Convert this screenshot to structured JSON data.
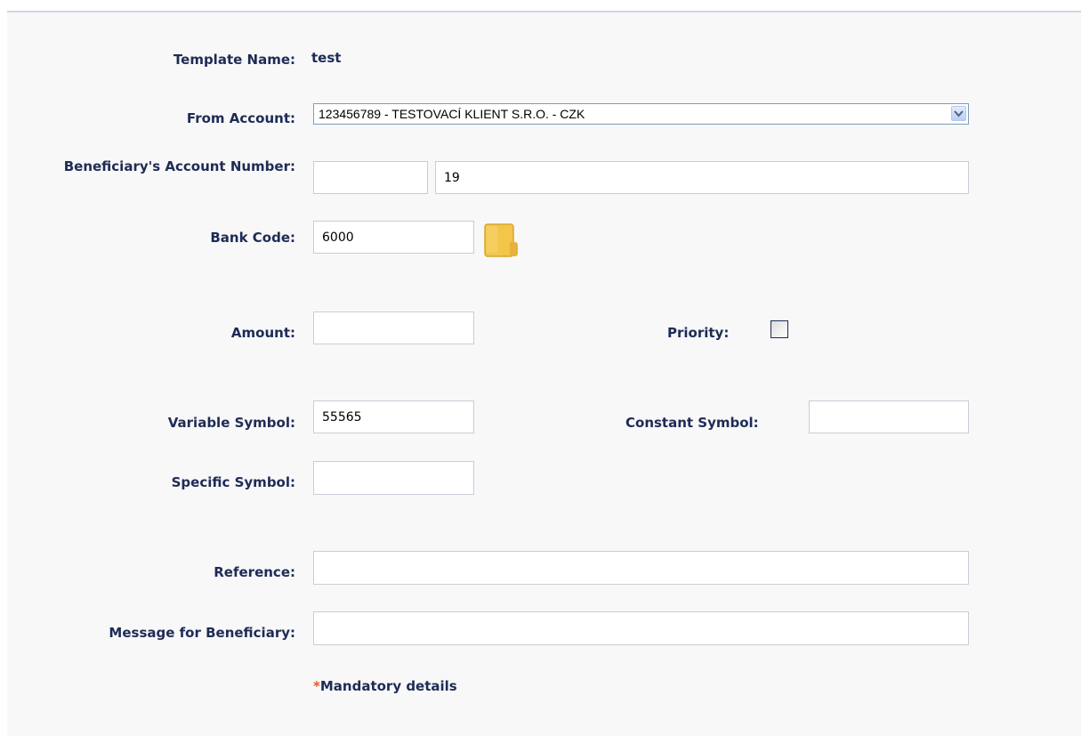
{
  "form": {
    "template_name": {
      "label": "Template Name:",
      "value": "test"
    },
    "from_account": {
      "label": "From Account:",
      "value": "123456789 - TESTOVACÍ KLIENT S.R.O. - CZK"
    },
    "beneficiary_account": {
      "label": "Beneficiary's Account Number:",
      "prefix": "",
      "number": "19"
    },
    "bank_code": {
      "label": "Bank Code:",
      "value": "6000",
      "icon": "folder-icon"
    },
    "amount": {
      "label": "Amount:",
      "value": ""
    },
    "priority": {
      "label": "Priority:",
      "checked": false
    },
    "variable_symbol": {
      "label": "Variable Symbol:",
      "value": "55565"
    },
    "constant_symbol": {
      "label": "Constant Symbol:",
      "value": ""
    },
    "specific_symbol": {
      "label": "Specific Symbol:",
      "value": ""
    },
    "reference": {
      "label": "Reference:",
      "value": ""
    },
    "message": {
      "label": "Message for Beneficiary:",
      "value": ""
    },
    "mandatory_note": {
      "star": "*",
      "text": "Mandatory details"
    }
  },
  "colors": {
    "label": "#1e2b55",
    "panel_bg": "#f8f8f9",
    "star": "#e4572e",
    "input_border": "#c8cdd6"
  }
}
